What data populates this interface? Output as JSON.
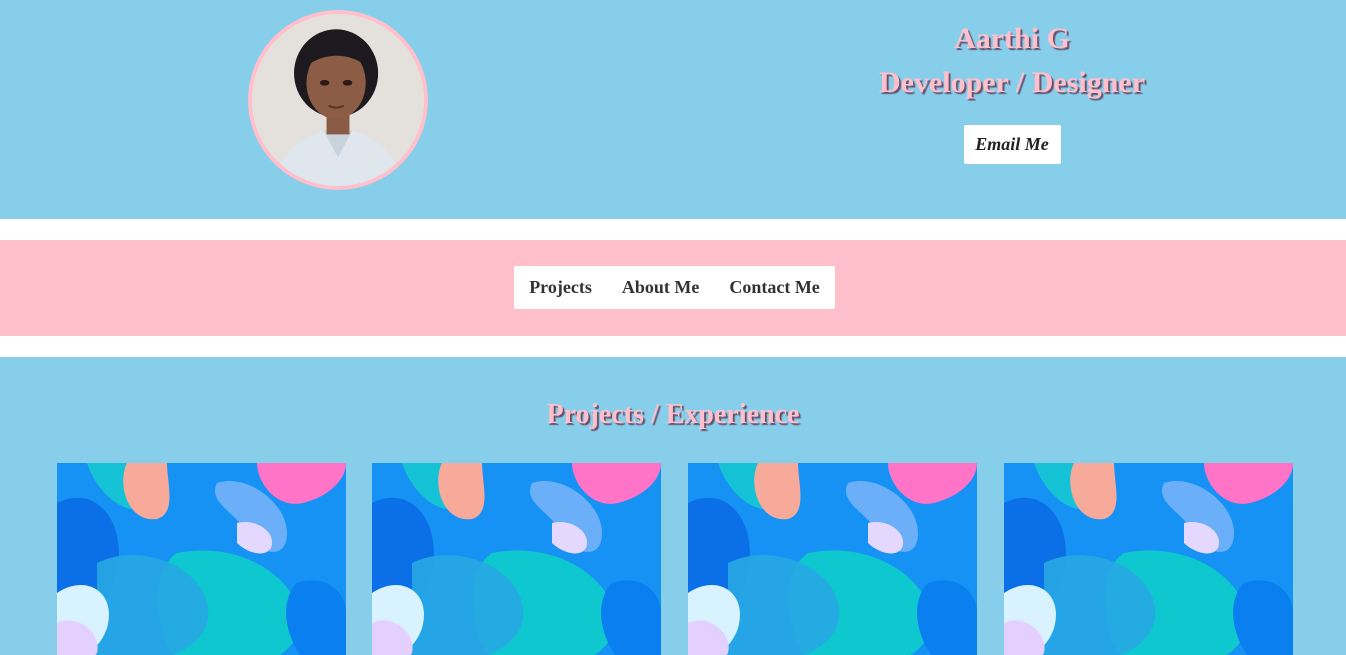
{
  "header": {
    "name": "Aarthi G",
    "role": "Developer / Designer",
    "email_button": "Email Me",
    "avatar_icon": "profile-photo"
  },
  "nav": {
    "items": [
      {
        "label": "Projects"
      },
      {
        "label": "About Me"
      },
      {
        "label": "Contact Me"
      }
    ]
  },
  "projects": {
    "title": "Projects / Experience",
    "cards": [
      {
        "image": "abstract-blob-background"
      },
      {
        "image": "abstract-blob-background"
      },
      {
        "image": "abstract-blob-background"
      },
      {
        "image": "abstract-blob-background"
      }
    ]
  },
  "colors": {
    "sky_blue": "#87ceeb",
    "pink": "#ffc0cb",
    "white": "#ffffff"
  }
}
